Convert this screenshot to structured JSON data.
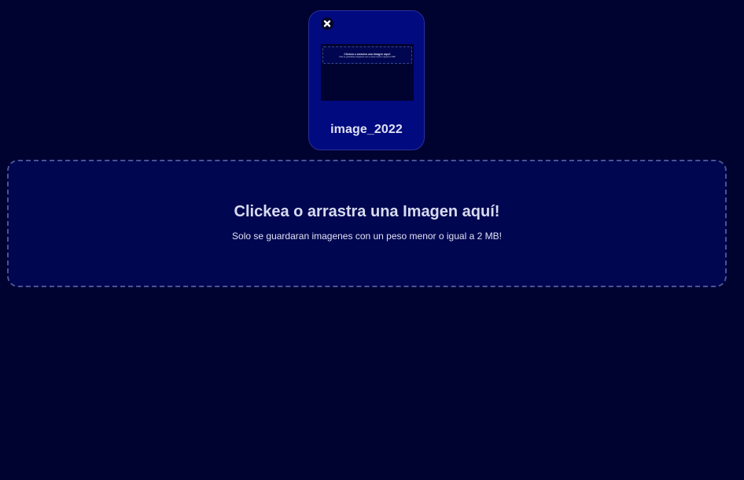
{
  "uploads": [
    {
      "name": "image_2022",
      "remove_icon": "close-icon",
      "thumbnail": {
        "title": "Clickea o arrastra una Imagen aquí!",
        "subtitle": "Solo se guardaran imagenes con un peso menor o igual a 2 MB!"
      }
    }
  ],
  "dropzone": {
    "title": "Clickea o arrastra una Imagen aquí!",
    "subtitle": "Solo se guardaran imagenes con un peso menor o igual a 2 MB!"
  },
  "colors": {
    "background": "#000230",
    "card": "#010a7e",
    "dropzone": "#000650",
    "dropzone_border": "#4b5590",
    "text": "#d7dbf0"
  }
}
